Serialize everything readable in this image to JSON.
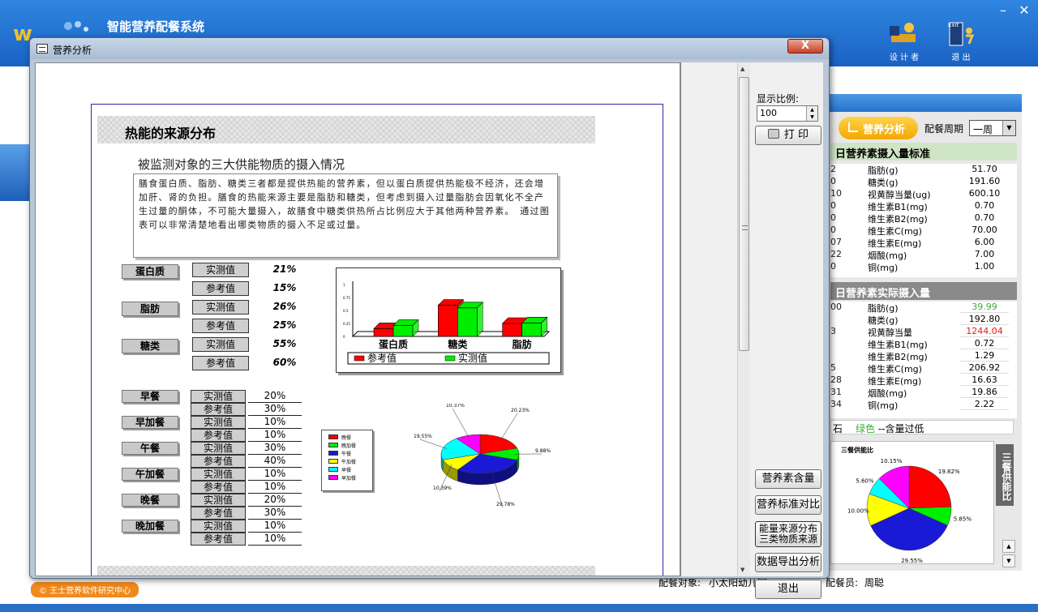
{
  "app": {
    "title": "智能营养配餐系统",
    "designer_label": "设 计 者",
    "exit_label": "退 出",
    "exit_en": "Exit",
    "copyright": "© 王士营养软件研究中心",
    "diner_label": "配餐对象:",
    "diner_value": "小太阳幼儿园",
    "staff_label": "配餐员:",
    "staff_value": "周聪"
  },
  "right_panel": {
    "analysis_button": "营养分析",
    "period_label": "配餐周期",
    "period_value": "一周",
    "std_title": "日营养素摄入量标准",
    "std_rows": [
      {
        "n": "2",
        "label": "脂肪(g)",
        "value": "51.70"
      },
      {
        "n": "0",
        "label": "糖类(g)",
        "value": "191.60"
      },
      {
        "n": "10",
        "label": "视黄醇当量(ug)",
        "value": "600.10"
      },
      {
        "n": "0",
        "label": "维生素B1(mg)",
        "value": "0.70"
      },
      {
        "n": "0",
        "label": "维生素B2(mg)",
        "value": "0.70"
      },
      {
        "n": "0",
        "label": "维生素C(mg)",
        "value": "70.00"
      },
      {
        "n": "07",
        "label": "维生素E(mg)",
        "value": "6.00"
      },
      {
        "n": "22",
        "label": "烟酸(mg)",
        "value": "7.00"
      },
      {
        "n": "0",
        "label": "铜(mg)",
        "value": "1.00"
      }
    ],
    "act_title": "日营养素实际摄入量",
    "act_rows": [
      {
        "n": "00",
        "label": "脂肪(g)",
        "value": "39.99",
        "color": "#3bb034"
      },
      {
        "n": "",
        "label": "糖类(g)",
        "value": "192.80",
        "color": "#000000"
      },
      {
        "n": "3",
        "label": "视黄醇当量",
        "value": "1244.04",
        "color": "#e02020"
      },
      {
        "n": "",
        "label": "维生素B1(mg)",
        "value": "0.72",
        "color": "#000000"
      },
      {
        "n": "",
        "label": "维生素B2(mg)",
        "value": "1.29",
        "color": "#000000"
      },
      {
        "n": "5",
        "label": "维生素C(mg)",
        "value": "206.92",
        "color": "#000000"
      },
      {
        "n": "28",
        "label": "维生素E(mg)",
        "value": "16.63",
        "color": "#000000"
      },
      {
        "n": "31",
        "label": "烟酸(mg)",
        "value": "19.86",
        "color": "#000000"
      },
      {
        "n": "34",
        "label": "铜(mg)",
        "value": "2.22",
        "color": "#000000"
      }
    ],
    "legend_prefix": "石",
    "legend_green": "绿色",
    "legend_suffix": "--含量过低",
    "pie_title": "三餐供能比",
    "side_tab": "三餐供能比",
    "pie_labels": [
      "19.82%",
      "5.85%",
      "29.55%",
      "10.00%",
      "5.60%",
      "10.15%"
    ]
  },
  "dialog": {
    "title": "营养分析",
    "close": "X",
    "zoom_label": "显示比例:",
    "zoom_value": "100",
    "print": "打 印",
    "buttons": {
      "nutri_content": "营养素含量",
      "standard_compare": "营养标准对比",
      "energy_source_1": "能量来源分布",
      "energy_source_2": "三类物质来源",
      "export": "数据导出分析",
      "exit": "退出"
    }
  },
  "report": {
    "section_title": "热能的来源分布",
    "subtitle": "被监测对象的三大供能物质的摄入情况",
    "description": "膳食蛋白质、脂肪、糖类三者都是提供热能的营养素，但以蛋白质提供热能极不经济，还会增加肝、肾的负担。膳食的热能来源主要是脂肪和糖类，但考虑到摄入过量脂肪会因氧化不全产生过量的酮体，不可能大量摄入，故膳食中糖类供热所占比例应大于其他两种营养素。　通过图表可以非常清楚地看出哪类物质的摄入不足或过量。",
    "measured_label": "实测值",
    "reference_label": "参考值",
    "macros": [
      {
        "name": "蛋白质",
        "measured": "21%",
        "reference": "15%"
      },
      {
        "name": "脂肪",
        "measured": "26%",
        "reference": "25%"
      },
      {
        "name": "糖类",
        "measured": "55%",
        "reference": "60%"
      }
    ],
    "meals": [
      {
        "name": "早餐",
        "measured": "20%",
        "reference": "30%"
      },
      {
        "name": "早加餐",
        "measured": "10%",
        "reference": "10%"
      },
      {
        "name": "午餐",
        "measured": "30%",
        "reference": "40%"
      },
      {
        "name": "午加餐",
        "measured": "10%",
        "reference": "10%"
      },
      {
        "name": "晚餐",
        "measured": "20%",
        "reference": "30%"
      },
      {
        "name": "晚加餐",
        "measured": "10%",
        "reference": "10%"
      }
    ]
  },
  "chart_data": [
    {
      "type": "bar",
      "categories": [
        "蛋白质",
        "糖类",
        "脂肪"
      ],
      "series": [
        {
          "name": "参考值",
          "values": [
            0.15,
            0.6,
            0.25
          ],
          "color": "#ff0000"
        },
        {
          "name": "实测值",
          "values": [
            0.21,
            0.55,
            0.26
          ],
          "color": "#00ee00"
        }
      ],
      "ylim": [
        0,
        1
      ],
      "yticks": [
        "0",
        "0.25",
        "0.5",
        "0.75",
        "1"
      ]
    },
    {
      "type": "pie",
      "labels": [
        "晚餐",
        "晚加餐",
        "午餐",
        "午加餐",
        "早餐",
        "早加餐"
      ],
      "values": [
        20.23,
        9.88,
        29.78,
        10.39,
        19.55,
        10.37
      ],
      "value_labels": [
        "20.23%",
        "9.88%",
        "29.78%",
        "10.39%",
        "19.55%",
        "10.37%"
      ],
      "colors": [
        "#ff0000",
        "#00ee00",
        "#1a1ad6",
        "#ffff00",
        "#00ffff",
        "#ff00ff"
      ]
    }
  ]
}
